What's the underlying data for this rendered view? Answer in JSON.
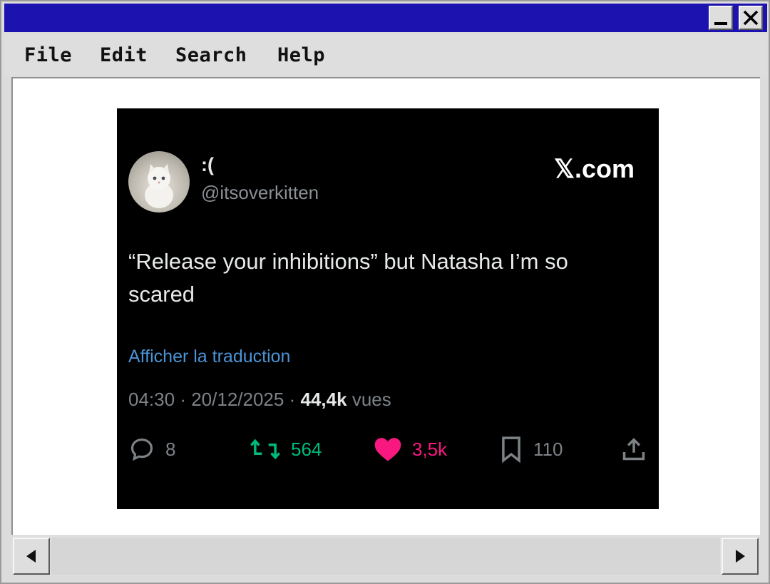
{
  "window": {
    "minimize_icon": "minimize-icon",
    "close_icon": "close-icon",
    "titlebar_color": "#1c12b0"
  },
  "menu": {
    "items": [
      "File",
      "Edit",
      "Search",
      "Help"
    ]
  },
  "tweet": {
    "display_name": ":(",
    "handle": "@itsoverkitten",
    "brand": "𝕏.com",
    "text": "“Release your inhibitions” but Natasha I’m so scared",
    "translate_link": "Afficher la traduction",
    "time": "04:30",
    "date": "20/12/2025",
    "views_count": "44,4k",
    "views_label": "vues",
    "separator": "·",
    "actions": {
      "replies": "8",
      "retweets": "564",
      "likes": "3,5k",
      "bookmarks": "110"
    },
    "colors": {
      "retweet": "#00ba7c",
      "like": "#f91880",
      "link": "#4b93d6"
    }
  },
  "scrollbar": {
    "left_icon": "arrow-left-icon",
    "right_icon": "arrow-right-icon"
  }
}
